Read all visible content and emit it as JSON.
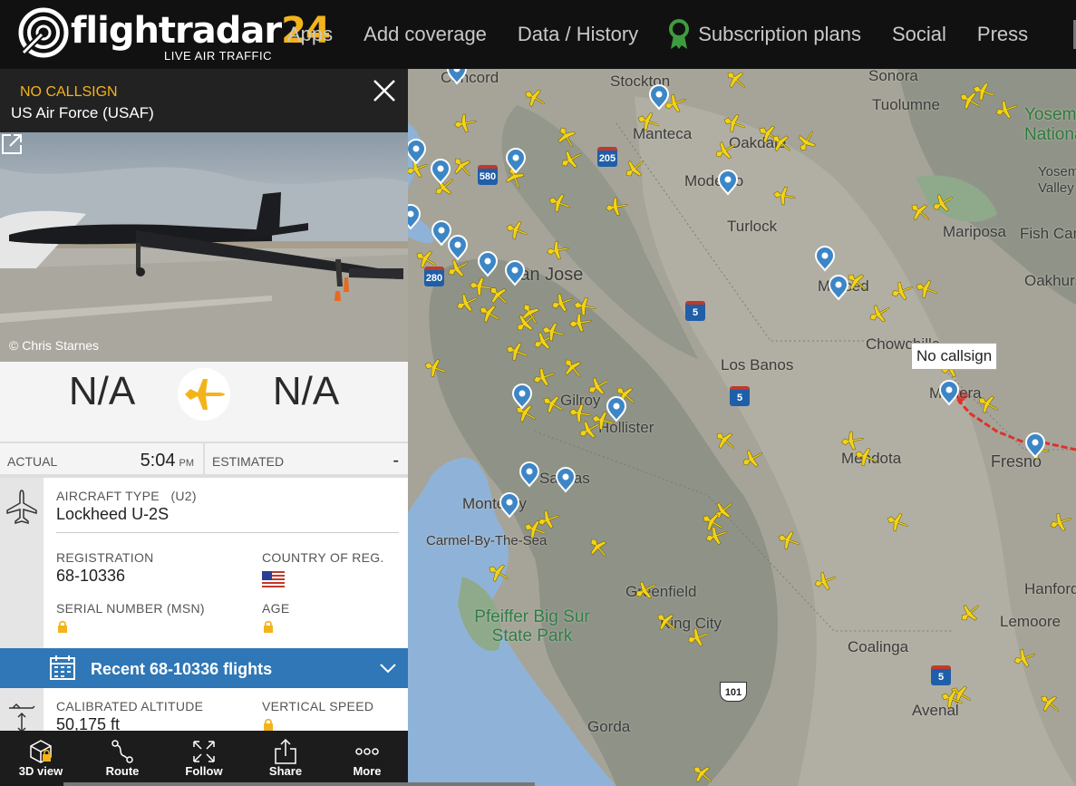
{
  "brand": {
    "name_main": "flightradar",
    "name_num": "24",
    "tagline": "LIVE AIR TRAFFIC"
  },
  "nav": [
    "Apps",
    "Add coverage",
    "Data / History",
    "Subscription plans",
    "Social",
    "Press"
  ],
  "panel": {
    "callsign": "NO CALLSIGN",
    "airline": "US Air Force (USAF)",
    "photo_credit": "© Chris Starnes",
    "origin": "N/A",
    "destination": "N/A",
    "actual_label": "ACTUAL",
    "actual_time": "5:04",
    "actual_ampm": "PM",
    "estimated_label": "ESTIMATED",
    "estimated_value": "-",
    "aircraft_type_label": "AIRCRAFT TYPE",
    "aircraft_type_code": "(U2)",
    "aircraft_type": "Lockheed U-2S",
    "registration_label": "REGISTRATION",
    "registration": "68-10336",
    "country_label": "COUNTRY OF REG.",
    "serial_label": "SERIAL NUMBER (MSN)",
    "age_label": "AGE",
    "recent_flights": "Recent 68-10336 flights",
    "calibrated_altitude_label": "CALIBRATED ALTITUDE",
    "calibrated_altitude": "50,175 ft",
    "vertical_speed_label": "VERTICAL SPEED"
  },
  "toolbar": [
    "3D view",
    "Route",
    "Follow",
    "Share",
    "More"
  ],
  "map": {
    "selected_callout": "No callsign",
    "places": [
      "Concord",
      "Stockton",
      "Sonora",
      "Tuolumne",
      "Yosemite National",
      "Manteca",
      "Oakdale",
      "Modesto",
      "Turlock",
      "Mariposa",
      "Fish Camp",
      "Yosemite Valley",
      "Merced",
      "Oakhurst",
      "San Jose",
      "Chowchilla",
      "Los Banos",
      "Madera",
      "Gilroy",
      "Hollister",
      "Mendota",
      "Fresno",
      "Salinas",
      "Monterey",
      "Carmel-By-The-Sea",
      "Greenfield",
      "King City",
      "Pfeiffer Big Sur State Park",
      "Coalinga",
      "Hanford",
      "Lemoore",
      "Avenal",
      "Gorda"
    ],
    "interstates": [
      "580",
      "205",
      "280",
      "5",
      "5",
      "5"
    ],
    "us_routes": [
      "101"
    ]
  },
  "colors": {
    "accent": "#f3b41b",
    "plane": "#f4d21a",
    "selected_track": "#e0312a",
    "recent_bar": "#2f77b6"
  }
}
